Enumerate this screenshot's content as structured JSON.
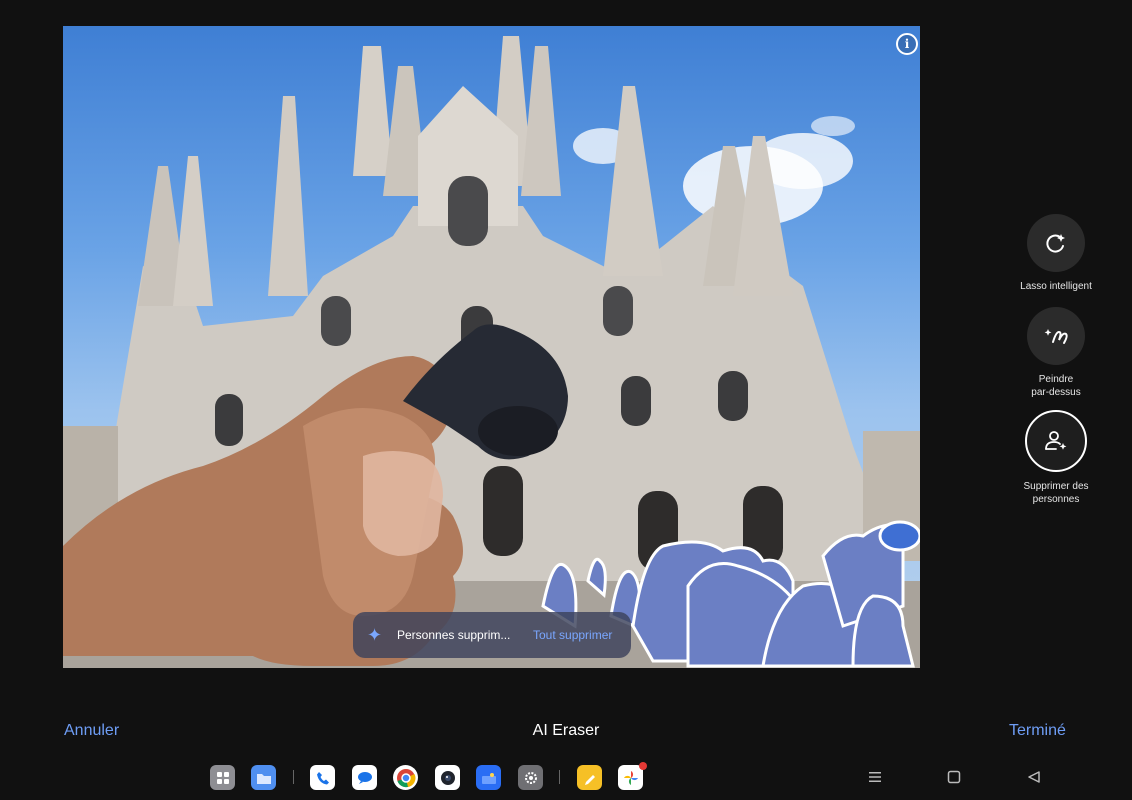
{
  "photo": {
    "alt_objects": [
      "cathedral",
      "hand-holding-earbud",
      "people-highlighted"
    ]
  },
  "toast": {
    "message": "Personnes supprim...",
    "action": "Tout supprimer"
  },
  "tools": [
    {
      "label": "Lasso intelligent",
      "icon": "smart-lasso-icon"
    },
    {
      "label_line1": "Peindre",
      "label_line2": "par-dessus",
      "icon": "paint-over-icon"
    },
    {
      "label_line1": "Supprimer des",
      "label_line2": "personnes",
      "icon": "remove-people-icon"
    }
  ],
  "bottom_bar": {
    "cancel": "Annuler",
    "title": "AI Eraser",
    "done": "Terminé"
  },
  "colors": {
    "accent": "#6e9df5",
    "background": "#111111"
  }
}
